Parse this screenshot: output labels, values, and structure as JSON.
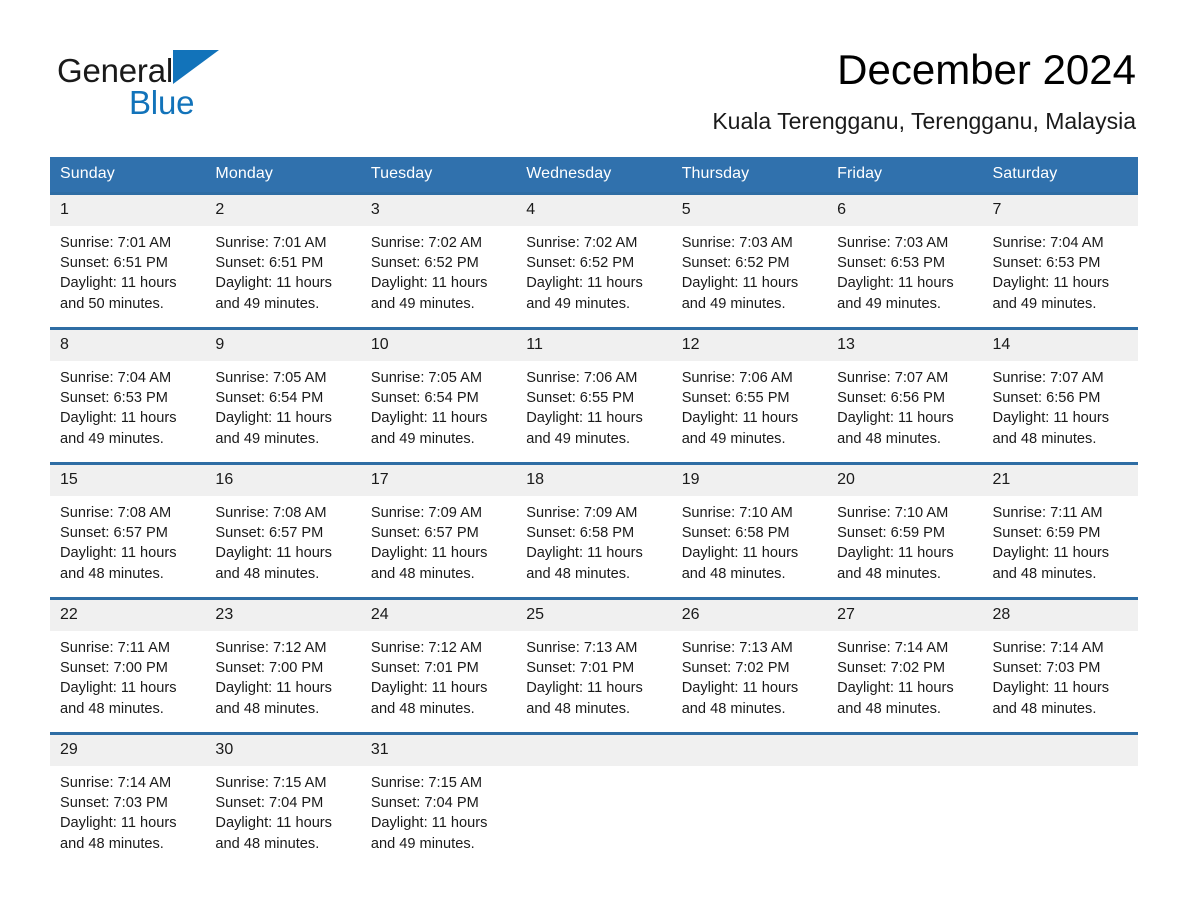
{
  "brand": {
    "name_part1": "General",
    "name_part2": "Blue",
    "logo_icon": "triangle-icon",
    "accent_color": "#1273ba"
  },
  "header": {
    "month_title": "December 2024",
    "location": "Kuala Terengganu, Terengganu, Malaysia"
  },
  "calendar": {
    "header_bg_color": "#3071ad",
    "row_border_color": "#2e6da4",
    "daynum_bg_color": "#f0f0f0",
    "weekdays": [
      "Sunday",
      "Monday",
      "Tuesday",
      "Wednesday",
      "Thursday",
      "Friday",
      "Saturday"
    ],
    "weeks": [
      [
        {
          "day": "1",
          "sunrise": "Sunrise: 7:01 AM",
          "sunset": "Sunset: 6:51 PM",
          "daylight_line1": "Daylight: 11 hours",
          "daylight_line2": "and 50 minutes."
        },
        {
          "day": "2",
          "sunrise": "Sunrise: 7:01 AM",
          "sunset": "Sunset: 6:51 PM",
          "daylight_line1": "Daylight: 11 hours",
          "daylight_line2": "and 49 minutes."
        },
        {
          "day": "3",
          "sunrise": "Sunrise: 7:02 AM",
          "sunset": "Sunset: 6:52 PM",
          "daylight_line1": "Daylight: 11 hours",
          "daylight_line2": "and 49 minutes."
        },
        {
          "day": "4",
          "sunrise": "Sunrise: 7:02 AM",
          "sunset": "Sunset: 6:52 PM",
          "daylight_line1": "Daylight: 11 hours",
          "daylight_line2": "and 49 minutes."
        },
        {
          "day": "5",
          "sunrise": "Sunrise: 7:03 AM",
          "sunset": "Sunset: 6:52 PM",
          "daylight_line1": "Daylight: 11 hours",
          "daylight_line2": "and 49 minutes."
        },
        {
          "day": "6",
          "sunrise": "Sunrise: 7:03 AM",
          "sunset": "Sunset: 6:53 PM",
          "daylight_line1": "Daylight: 11 hours",
          "daylight_line2": "and 49 minutes."
        },
        {
          "day": "7",
          "sunrise": "Sunrise: 7:04 AM",
          "sunset": "Sunset: 6:53 PM",
          "daylight_line1": "Daylight: 11 hours",
          "daylight_line2": "and 49 minutes."
        }
      ],
      [
        {
          "day": "8",
          "sunrise": "Sunrise: 7:04 AM",
          "sunset": "Sunset: 6:53 PM",
          "daylight_line1": "Daylight: 11 hours",
          "daylight_line2": "and 49 minutes."
        },
        {
          "day": "9",
          "sunrise": "Sunrise: 7:05 AM",
          "sunset": "Sunset: 6:54 PM",
          "daylight_line1": "Daylight: 11 hours",
          "daylight_line2": "and 49 minutes."
        },
        {
          "day": "10",
          "sunrise": "Sunrise: 7:05 AM",
          "sunset": "Sunset: 6:54 PM",
          "daylight_line1": "Daylight: 11 hours",
          "daylight_line2": "and 49 minutes."
        },
        {
          "day": "11",
          "sunrise": "Sunrise: 7:06 AM",
          "sunset": "Sunset: 6:55 PM",
          "daylight_line1": "Daylight: 11 hours",
          "daylight_line2": "and 49 minutes."
        },
        {
          "day": "12",
          "sunrise": "Sunrise: 7:06 AM",
          "sunset": "Sunset: 6:55 PM",
          "daylight_line1": "Daylight: 11 hours",
          "daylight_line2": "and 49 minutes."
        },
        {
          "day": "13",
          "sunrise": "Sunrise: 7:07 AM",
          "sunset": "Sunset: 6:56 PM",
          "daylight_line1": "Daylight: 11 hours",
          "daylight_line2": "and 48 minutes."
        },
        {
          "day": "14",
          "sunrise": "Sunrise: 7:07 AM",
          "sunset": "Sunset: 6:56 PM",
          "daylight_line1": "Daylight: 11 hours",
          "daylight_line2": "and 48 minutes."
        }
      ],
      [
        {
          "day": "15",
          "sunrise": "Sunrise: 7:08 AM",
          "sunset": "Sunset: 6:57 PM",
          "daylight_line1": "Daylight: 11 hours",
          "daylight_line2": "and 48 minutes."
        },
        {
          "day": "16",
          "sunrise": "Sunrise: 7:08 AM",
          "sunset": "Sunset: 6:57 PM",
          "daylight_line1": "Daylight: 11 hours",
          "daylight_line2": "and 48 minutes."
        },
        {
          "day": "17",
          "sunrise": "Sunrise: 7:09 AM",
          "sunset": "Sunset: 6:57 PM",
          "daylight_line1": "Daylight: 11 hours",
          "daylight_line2": "and 48 minutes."
        },
        {
          "day": "18",
          "sunrise": "Sunrise: 7:09 AM",
          "sunset": "Sunset: 6:58 PM",
          "daylight_line1": "Daylight: 11 hours",
          "daylight_line2": "and 48 minutes."
        },
        {
          "day": "19",
          "sunrise": "Sunrise: 7:10 AM",
          "sunset": "Sunset: 6:58 PM",
          "daylight_line1": "Daylight: 11 hours",
          "daylight_line2": "and 48 minutes."
        },
        {
          "day": "20",
          "sunrise": "Sunrise: 7:10 AM",
          "sunset": "Sunset: 6:59 PM",
          "daylight_line1": "Daylight: 11 hours",
          "daylight_line2": "and 48 minutes."
        },
        {
          "day": "21",
          "sunrise": "Sunrise: 7:11 AM",
          "sunset": "Sunset: 6:59 PM",
          "daylight_line1": "Daylight: 11 hours",
          "daylight_line2": "and 48 minutes."
        }
      ],
      [
        {
          "day": "22",
          "sunrise": "Sunrise: 7:11 AM",
          "sunset": "Sunset: 7:00 PM",
          "daylight_line1": "Daylight: 11 hours",
          "daylight_line2": "and 48 minutes."
        },
        {
          "day": "23",
          "sunrise": "Sunrise: 7:12 AM",
          "sunset": "Sunset: 7:00 PM",
          "daylight_line1": "Daylight: 11 hours",
          "daylight_line2": "and 48 minutes."
        },
        {
          "day": "24",
          "sunrise": "Sunrise: 7:12 AM",
          "sunset": "Sunset: 7:01 PM",
          "daylight_line1": "Daylight: 11 hours",
          "daylight_line2": "and 48 minutes."
        },
        {
          "day": "25",
          "sunrise": "Sunrise: 7:13 AM",
          "sunset": "Sunset: 7:01 PM",
          "daylight_line1": "Daylight: 11 hours",
          "daylight_line2": "and 48 minutes."
        },
        {
          "day": "26",
          "sunrise": "Sunrise: 7:13 AM",
          "sunset": "Sunset: 7:02 PM",
          "daylight_line1": "Daylight: 11 hours",
          "daylight_line2": "and 48 minutes."
        },
        {
          "day": "27",
          "sunrise": "Sunrise: 7:14 AM",
          "sunset": "Sunset: 7:02 PM",
          "daylight_line1": "Daylight: 11 hours",
          "daylight_line2": "and 48 minutes."
        },
        {
          "day": "28",
          "sunrise": "Sunrise: 7:14 AM",
          "sunset": "Sunset: 7:03 PM",
          "daylight_line1": "Daylight: 11 hours",
          "daylight_line2": "and 48 minutes."
        }
      ],
      [
        {
          "day": "29",
          "sunrise": "Sunrise: 7:14 AM",
          "sunset": "Sunset: 7:03 PM",
          "daylight_line1": "Daylight: 11 hours",
          "daylight_line2": "and 48 minutes."
        },
        {
          "day": "30",
          "sunrise": "Sunrise: 7:15 AM",
          "sunset": "Sunset: 7:04 PM",
          "daylight_line1": "Daylight: 11 hours",
          "daylight_line2": "and 48 minutes."
        },
        {
          "day": "31",
          "sunrise": "Sunrise: 7:15 AM",
          "sunset": "Sunset: 7:04 PM",
          "daylight_line1": "Daylight: 11 hours",
          "daylight_line2": "and 49 minutes."
        },
        {
          "day": "",
          "sunrise": "",
          "sunset": "",
          "daylight_line1": "",
          "daylight_line2": ""
        },
        {
          "day": "",
          "sunrise": "",
          "sunset": "",
          "daylight_line1": "",
          "daylight_line2": ""
        },
        {
          "day": "",
          "sunrise": "",
          "sunset": "",
          "daylight_line1": "",
          "daylight_line2": ""
        },
        {
          "day": "",
          "sunrise": "",
          "sunset": "",
          "daylight_line1": "",
          "daylight_line2": ""
        }
      ]
    ]
  }
}
